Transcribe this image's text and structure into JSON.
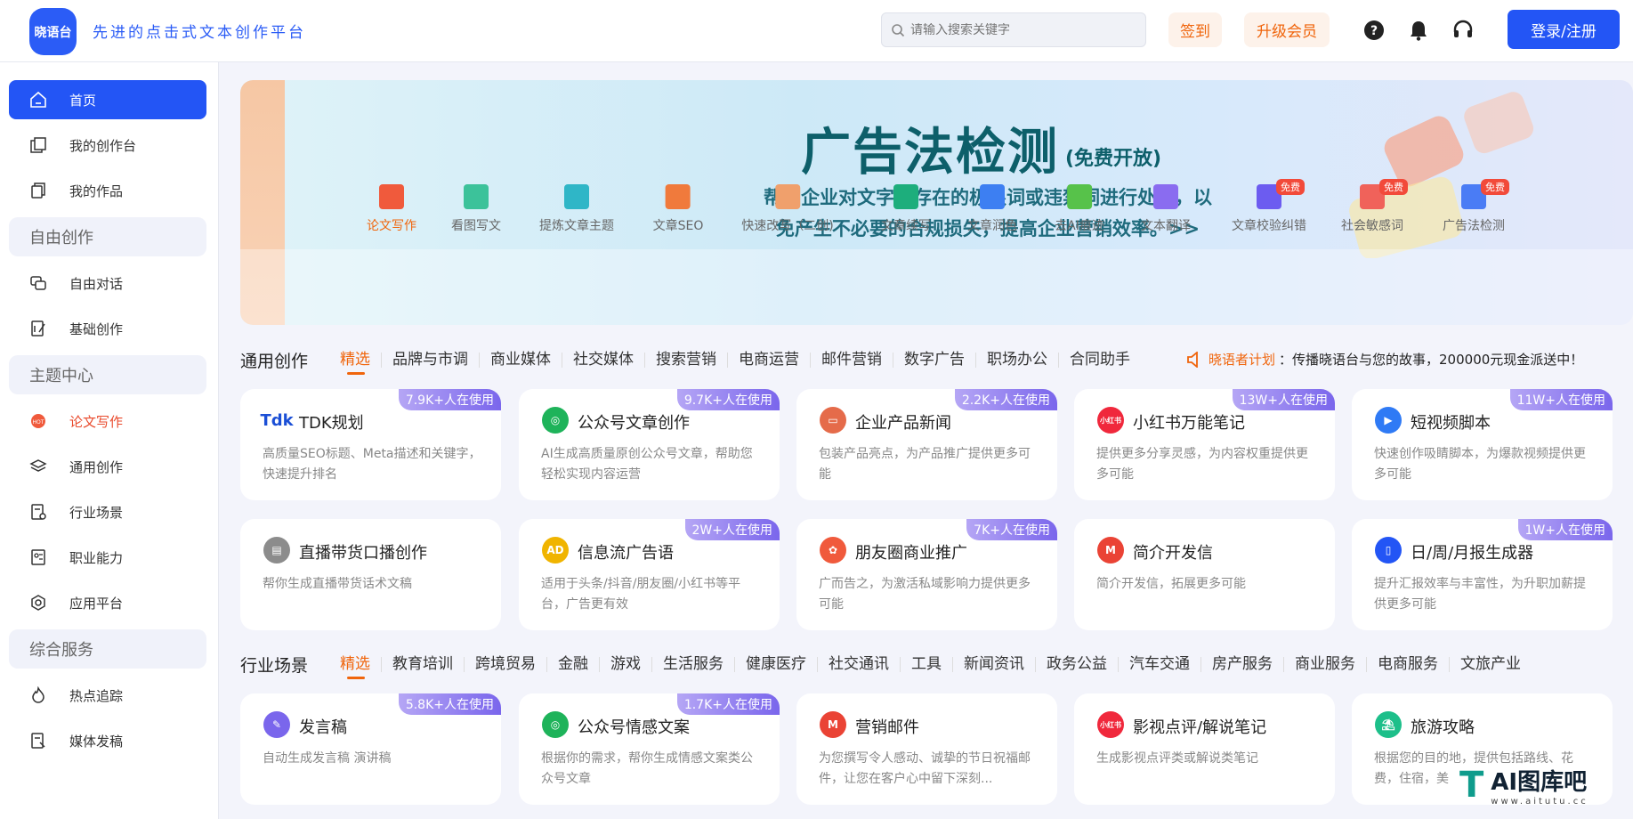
{
  "header": {
    "logo_text": "晓语台",
    "slogan": "先进的点击式文本创作平台",
    "search_placeholder": "请输入搜索关键字",
    "signin": "签到",
    "upgrade": "升级会员",
    "login": "登录/注册"
  },
  "sidebar": {
    "items": [
      {
        "label": "首页",
        "icon": "home-icon"
      },
      {
        "label": "我的创作台",
        "icon": "workbench-icon"
      },
      {
        "label": "我的作品",
        "icon": "works-icon"
      }
    ],
    "group_free": "自由创作",
    "free_items": [
      {
        "label": "自由对话",
        "icon": "chat-icon"
      },
      {
        "label": "基础创作",
        "icon": "edit-icon"
      }
    ],
    "group_topic": "主题中心",
    "topic_items": [
      {
        "label": "论文写作",
        "icon": "paper-icon"
      },
      {
        "label": "通用创作",
        "icon": "layers-icon"
      },
      {
        "label": "行业场景",
        "icon": "industry-icon"
      },
      {
        "label": "职业能力",
        "icon": "career-icon"
      },
      {
        "label": "应用平台",
        "icon": "platform-icon"
      }
    ],
    "group_service": "综合服务",
    "service_items": [
      {
        "label": "热点追踪",
        "icon": "hot-icon"
      },
      {
        "label": "媒体发稿",
        "icon": "media-icon"
      }
    ]
  },
  "banner": {
    "title": "广告法检测",
    "tag": "(免费开放)",
    "desc1": "帮助企业对文字中存在的极限词或违禁词进行处理，以",
    "desc2": "免产生不必要的合规损失，提高企业营销效率。>>",
    "tools": [
      {
        "label": "论文写作",
        "color": "#f05a3c",
        "free": ""
      },
      {
        "label": "看图写文",
        "color": "#3cc29a",
        "free": ""
      },
      {
        "label": "提炼文章主题",
        "color": "#2fb6c7",
        "free": ""
      },
      {
        "label": "文章SEO",
        "color": "#f07a3c",
        "free": ""
      },
      {
        "label": "快速改写（二创)",
        "color": "#f0a06c",
        "free": ""
      },
      {
        "label": "文章续写",
        "color": "#1dae7c",
        "free": ""
      },
      {
        "label": "文章润色",
        "color": "#3d7ff2",
        "free": ""
      },
      {
        "label": "去AI痕迹",
        "color": "#57c24a",
        "free": ""
      },
      {
        "label": "文本翻译",
        "color": "#8a6cf0",
        "free": ""
      },
      {
        "label": "文章校验纠错",
        "color": "#6c5cf0",
        "free": "免费"
      },
      {
        "label": "社会敏感词",
        "color": "#f0625a",
        "free": "免费"
      },
      {
        "label": "广告法检测",
        "color": "#4a7cf5",
        "free": "免费"
      }
    ]
  },
  "general": {
    "title": "通用创作",
    "tabs": [
      "精选",
      "品牌与市调",
      "商业媒体",
      "社交媒体",
      "搜索营销",
      "电商运营",
      "邮件营销",
      "数字广告",
      "职场办公",
      "合同助手"
    ],
    "plan_name": "晓语者计划",
    "plan_text": "：传播晓语台与您的故事，200000元现金派送中！",
    "cards": [
      {
        "title": "TDK规划",
        "desc": "高质量SEO标题、Meta描述和关键字，快速提升排名",
        "badge": "7.9K+人在使用",
        "icon_text": "Tdk",
        "color": "#1b4fd6"
      },
      {
        "title": "公众号文章创作",
        "desc": "AI生成高质量原创公众号文章，帮助您轻松实现内容运营",
        "badge": "9.7K+人在使用",
        "icon_text": "◎",
        "color": "#1eb35a"
      },
      {
        "title": "企业产品新闻",
        "desc": "包装产品亮点，为产品推广提供更多可能",
        "badge": "2.2K+人在使用",
        "icon_text": "▭",
        "color": "#e56b4a"
      },
      {
        "title": "小红书万能笔记",
        "desc": "提供更多分享灵感，为内容权重提供更多可能",
        "badge": "13W+人在使用",
        "icon_text": "小红书",
        "color": "#f0283c"
      },
      {
        "title": "短视频脚本",
        "desc": "快速创作吸睛脚本，为爆款视频提供更多可能",
        "badge": "11W+人在使用",
        "icon_text": "▶",
        "color": "#2f7af5"
      },
      {
        "title": "直播带货口播创作",
        "desc": "帮你生成直播带货话术文稿",
        "badge": "",
        "icon_text": "▤",
        "color": "#8c8c8c"
      },
      {
        "title": "信息流广告语",
        "desc": "适用于头条/抖音/朋友圈/小红书等平台，广告更有效",
        "badge": "2W+人在使用",
        "icon_text": "AD",
        "color": "#f0b400"
      },
      {
        "title": "朋友圈商业推广",
        "desc": "广而告之，为激活私域影响力提供更多可能",
        "badge": "7K+人在使用",
        "icon_text": "✿",
        "color": "#f05a3c"
      },
      {
        "title": "简介开发信",
        "desc": "简介开发信，拓展更多可能",
        "badge": "",
        "icon_text": "M",
        "color": "#ea4335"
      },
      {
        "title": "日/周/月报生成器",
        "desc": "提升汇报效率与丰富性，为升职加薪提供更多可能",
        "badge": "1W+人在使用",
        "icon_text": "▯",
        "color": "#2355f5"
      }
    ]
  },
  "industry": {
    "title": "行业场景",
    "tabs": [
      "精选",
      "教育培训",
      "跨境贸易",
      "金融",
      "游戏",
      "生活服务",
      "健康医疗",
      "社交通讯",
      "工具",
      "新闻资讯",
      "政务公益",
      "汽车交通",
      "房产服务",
      "商业服务",
      "电商服务",
      "文旅产业"
    ],
    "cards": [
      {
        "title": "发言稿",
        "desc": "自动生成发言稿 演讲稿",
        "badge": "5.8K+人在使用",
        "icon_text": "✎",
        "color": "#7a66ec"
      },
      {
        "title": "公众号情感文案",
        "desc": "根据你的需求，帮你生成情感文案类公众号文章",
        "badge": "1.7K+人在使用",
        "icon_text": "◎",
        "color": "#1eb35a"
      },
      {
        "title": "营销邮件",
        "desc": "为您撰写令人感动、诚挚的节日祝福邮件，让您在客户心中留下深刻...",
        "badge": "",
        "icon_text": "M",
        "color": "#ea4335"
      },
      {
        "title": "影视点评/解说笔记",
        "desc": "生成影视点评类或解说类笔记",
        "badge": "",
        "icon_text": "小红书",
        "color": "#f0283c"
      },
      {
        "title": "旅游攻略",
        "desc": "根据您的目的地，提供包括路线、花费，住宿，美",
        "badge": "",
        "icon_text": "⛱",
        "color": "#1dbf8a"
      }
    ]
  },
  "watermark": {
    "text": "AI图库吧",
    "url": "www.aitutu.cc"
  }
}
